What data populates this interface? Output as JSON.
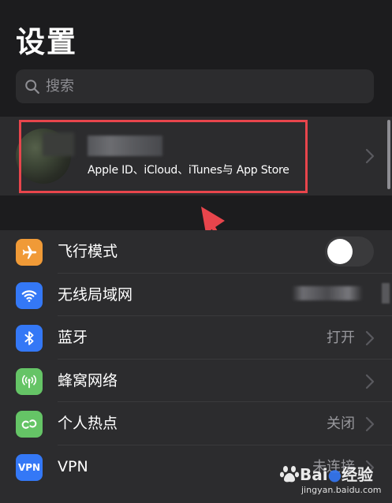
{
  "header": {
    "title": "设置"
  },
  "search": {
    "placeholder": "搜索"
  },
  "account": {
    "subtitle": "Apple ID、iCloud、iTunes与 App Store"
  },
  "settings": {
    "rows": [
      {
        "label": "飞行模式",
        "value": "",
        "icon_color": "#f09a37",
        "icon": "airplane-icon",
        "control": "toggle",
        "toggle_on": false
      },
      {
        "label": "无线局域网",
        "value": "",
        "icon_color": "#3478f6",
        "icon": "wifi-icon"
      },
      {
        "label": "蓝牙",
        "value": "打开",
        "icon_color": "#3478f6",
        "icon": "bluetooth-icon"
      },
      {
        "label": "蜂窝网络",
        "value": "",
        "icon_color": "#65c466",
        "icon": "cellular-icon"
      },
      {
        "label": "个人热点",
        "value": "关闭",
        "icon_color": "#65c466",
        "icon": "hotspot-icon"
      },
      {
        "label": "VPN",
        "value": "未连接",
        "icon_color": "#3478f6",
        "icon": "vpn-icon",
        "icon_text": "VPN"
      }
    ]
  },
  "annotation": {
    "highlight_color": "#e8454c"
  },
  "watermark": {
    "brand": "Bai",
    "brand_suffix": "经验",
    "url": "jingyan.baidu.com"
  }
}
